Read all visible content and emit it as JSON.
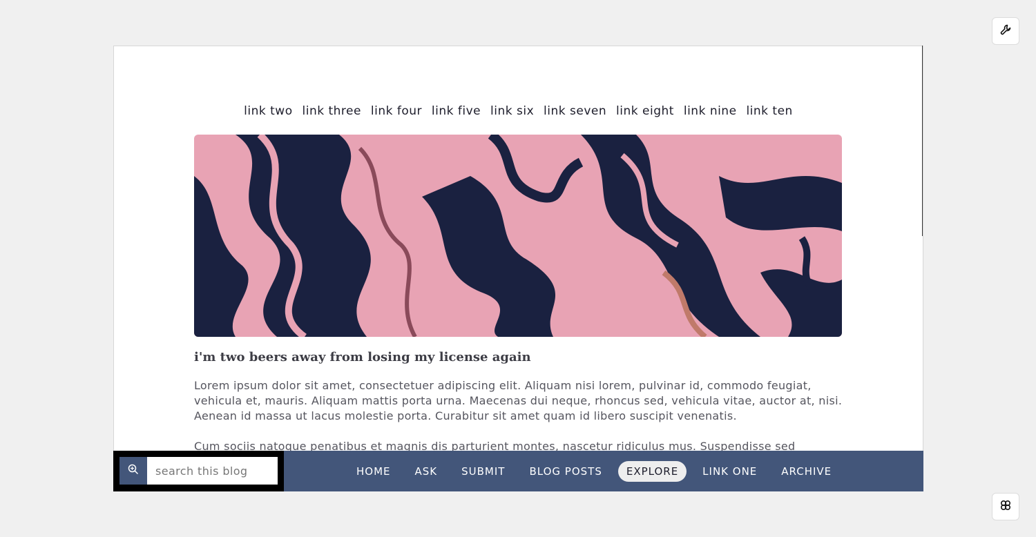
{
  "header_links": [
    "link two",
    "link three",
    "link four",
    "link five",
    "link six",
    "link seven",
    "link eight",
    "link nine",
    "link ten"
  ],
  "post": {
    "title": "i'm two beers away from losing my license again",
    "paragraphs": [
      "Lorem ipsum dolor sit amet, consectetuer adipiscing elit. Aliquam nisi lorem, pulvinar id, commodo feugiat, vehicula et, mauris. Aliquam mattis porta urna. Maecenas dui neque, rhoncus sed, vehicula vitae, auctor at, nisi. Aenean id massa ut lacus molestie porta. Curabitur sit amet quam id libero suscipit venenatis.",
      "Cum sociis natoque penatibus et magnis dis parturient montes, nascetur ridiculus mus. Suspendisse sed"
    ]
  },
  "search": {
    "placeholder": "search this blog"
  },
  "nav": {
    "items": [
      "HOME",
      "ASK",
      "SUBMIT",
      "BLOG POSTS",
      "EXPLORE",
      "LINK ONE",
      "ARCHIVE"
    ],
    "active": "EXPLORE"
  },
  "colors": {
    "nav_bg": "#43567a",
    "banner_pink": "#e8a3b4",
    "banner_navy": "#1a2140"
  },
  "icons": {
    "top_button": "wrench-icon",
    "bottom_button": "clover-icon",
    "search": "zoom-in-icon"
  }
}
